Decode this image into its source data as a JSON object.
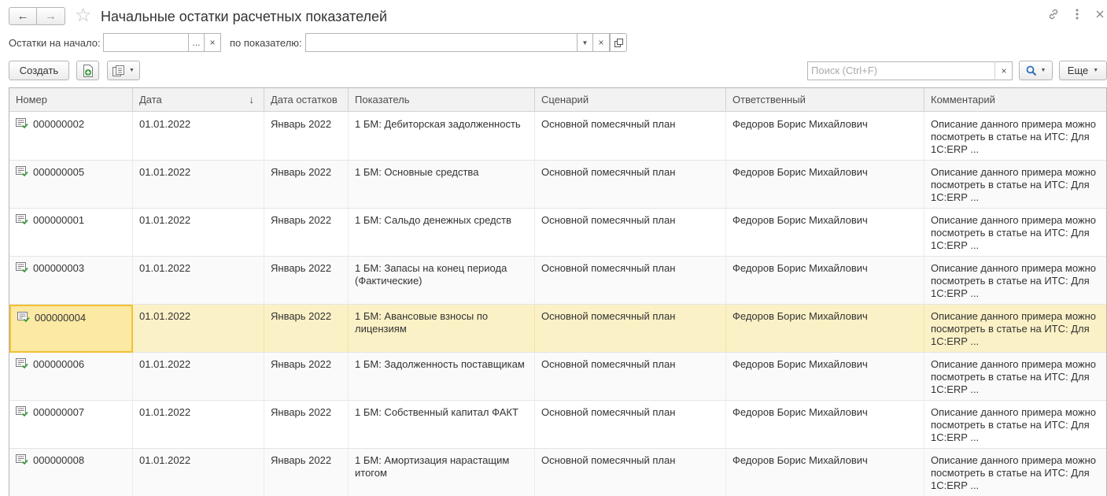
{
  "window": {
    "title": "Начальные остатки расчетных показателей"
  },
  "filters": {
    "start_label": "Остатки на начало:",
    "start_value": "",
    "start_select_btn": "...",
    "clear_symbol": "×",
    "indicator_label": "по показателю:",
    "indicator_value": ""
  },
  "toolbar": {
    "create_label": "Создать",
    "search_placeholder": "Поиск (Ctrl+F)",
    "more_label": "Еще"
  },
  "table": {
    "columns": [
      "Номер",
      "Дата",
      "Дата остатков",
      "Показатель",
      "Сценарий",
      "Ответственный",
      "Комментарий"
    ],
    "rows": [
      {
        "number": "000000002",
        "date": "01.01.2022",
        "balance_date": "Январь 2022",
        "indicator": "1 БМ: Дебиторская задолженность",
        "scenario": "Основной помесячный план",
        "responsible": "Федоров Борис Михайлович",
        "comment": "Описание данного примера можно посмотреть в статье на ИТС: Для 1С:ERP ..."
      },
      {
        "number": "000000005",
        "date": "01.01.2022",
        "balance_date": "Январь 2022",
        "indicator": "1 БМ: Основные средства",
        "scenario": "Основной помесячный план",
        "responsible": "Федоров Борис Михайлович",
        "comment": "Описание данного примера можно посмотреть в статье на ИТС: Для 1С:ERP ..."
      },
      {
        "number": "000000001",
        "date": "01.01.2022",
        "balance_date": "Январь 2022",
        "indicator": "1 БМ: Сальдо денежных средств",
        "scenario": "Основной помесячный план",
        "responsible": "Федоров Борис Михайлович",
        "comment": "Описание данного примера можно посмотреть в статье на ИТС: Для 1С:ERP ..."
      },
      {
        "number": "000000003",
        "date": "01.01.2022",
        "balance_date": "Январь 2022",
        "indicator": "1 БМ: Запасы на конец периода (Фактические)",
        "scenario": "Основной помесячный план",
        "responsible": "Федоров Борис Михайлович",
        "comment": "Описание данного примера можно посмотреть в статье на ИТС: Для 1С:ERP ..."
      },
      {
        "number": "000000004",
        "date": "01.01.2022",
        "balance_date": "Январь 2022",
        "indicator": "1 БМ: Авансовые взносы по лицензиям",
        "scenario": "Основной помесячный план",
        "responsible": "Федоров Борис Михайлович",
        "comment": "Описание данного примера можно посмотреть в статье на ИТС: Для 1С:ERP ..."
      },
      {
        "number": "000000006",
        "date": "01.01.2022",
        "balance_date": "Январь 2022",
        "indicator": "1 БМ: Задолженность поставщикам",
        "scenario": "Основной помесячный план",
        "responsible": "Федоров Борис Михайлович",
        "comment": "Описание данного примера можно посмотреть в статье на ИТС: Для 1С:ERP ..."
      },
      {
        "number": "000000007",
        "date": "01.01.2022",
        "balance_date": "Январь 2022",
        "indicator": "1 БМ: Собственный капитал ФАКТ",
        "scenario": "Основной помесячный план",
        "responsible": "Федоров Борис Михайлович",
        "comment": "Описание данного примера можно посмотреть в статье на ИТС: Для 1С:ERP ..."
      },
      {
        "number": "000000008",
        "date": "01.01.2022",
        "balance_date": "Январь 2022",
        "indicator": "1 БМ: Амортизация нарастащим итогом",
        "scenario": "Основной помесячный план",
        "responsible": "Федоров Борис Михайлович",
        "comment": "Описание данного примера можно посмотреть в статье на ИТС: Для 1С:ERP ..."
      }
    ],
    "selected_row_number": "000000004"
  },
  "icons": {
    "back": "arrow-left-icon",
    "forward": "arrow-right-icon",
    "favorite": "star-icon",
    "link": "link-icon",
    "menu": "more-vertical-icon",
    "close": "close-icon",
    "doc": "document-posted-icon"
  },
  "colors": {
    "selected_row": "#fbf1c6",
    "focus_border": "#f1c232",
    "doc_icon_green": "#3a9a3a"
  }
}
